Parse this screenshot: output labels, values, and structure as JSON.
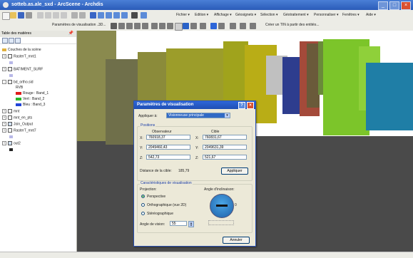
{
  "window": {
    "title": "sotteb.as.ale_sxd - ArcScene - Archdis"
  },
  "menubar": {
    "items": [
      "Fichier ▾",
      "Edition ▾",
      "Affichage ▾",
      "Géosignets ▾",
      "Sélection ▾",
      "Géotraitement ▾",
      "Personnaliser ▾",
      "Fenêtres ▾",
      "Aide ▾"
    ]
  },
  "toolbar2": {
    "viewparams_label": "Paramètres de visualisation ...",
    "mode_label": "3D...",
    "tin_label": "Créer un TIN à partir des entités..."
  },
  "toc": {
    "title": "Table des matières",
    "pin": "&#x2715;",
    "scene_label": "Couches de la scène",
    "layers": [
      "RasterT_mnt1",
      "BATIMENT_SURF",
      "bd_ortho.sid",
      "RVB",
      "Rouge : Band_1",
      "Vert : Band_2",
      "Bleu : Band_3",
      "mnt",
      "mnt_en_pts",
      "Join_Output",
      "RasterT_mnt7",
      "out2"
    ]
  },
  "dialog": {
    "title": "Paramètres de visualisation",
    "apply_to_label": "Appliquer à:",
    "apply_to_value": "Visionneuse principale",
    "positions_label": "Positions",
    "observer_label": "Observateur",
    "target_label": "Cible",
    "observer": {
      "x": "760918,37",
      "y": "2049460,43",
      "z": "542,73"
    },
    "target": {
      "x": "760831,67",
      "y": "2049631,39",
      "z": "521,67"
    },
    "distance_label": "Distance de la cible:",
    "distance_value": "185,79",
    "apply_button": "Appliquer",
    "view_label": "Caractéristiques de visualisation",
    "projection_label": "Projection:",
    "proj_perspective": "Perspective",
    "proj_ortho": "Orthographique (vue 2D)",
    "proj_stereo": "Stéréographique",
    "tilt_label": "Angle d'inclinaison:",
    "tilt_value": "0",
    "fov_label": "Angle de vision:",
    "fov_value": "55",
    "cancel_button": "Annuler",
    "x_label": "X:",
    "y_label": "Y:",
    "z_label": "Z:"
  },
  "colors": {
    "accent": "#2d66d8",
    "ground": "#4a4a4a"
  }
}
